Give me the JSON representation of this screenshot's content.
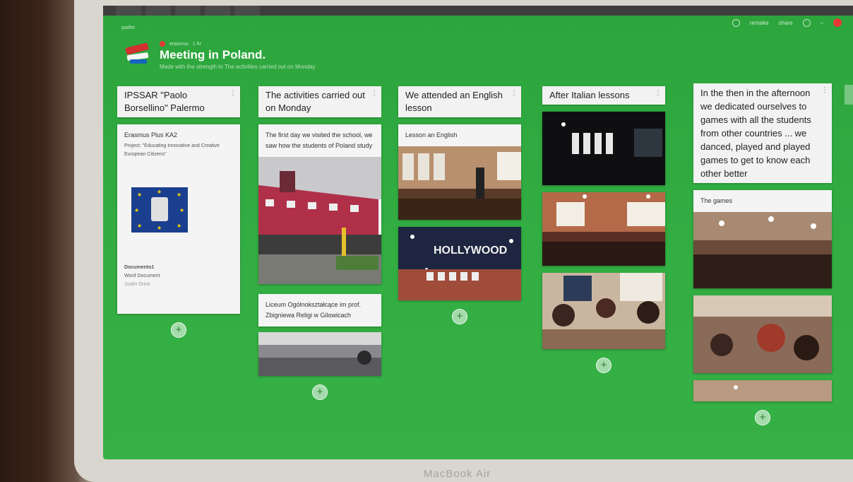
{
  "board": {
    "title": "Meeting in Poland.",
    "subtitle": "Made with the strength to The activities carried out on Monday",
    "author_name": "erasmus",
    "author_time": "1 hr"
  },
  "browser_tabs": [
    "",
    "",
    "",
    "",
    ""
  ],
  "topbar": {
    "item1": "remake",
    "item2": "share"
  },
  "columns": [
    {
      "header": "IPSSAR \"Paolo Borsellino\" Palermo",
      "card1_title": "Erasmus Plus KA2",
      "card1_body": "Project: \"Educating Innovative and Creative European Citizens\"",
      "attachment_name": "Documento1",
      "attachment_type": "Word Document",
      "attachment_src": "Justin Drive"
    },
    {
      "header": "The activities carried out on Monday",
      "card1_text": "The first day we visited the school, we saw how the students of Poland study",
      "card2_text": "Liceum Ogólnokształcące im prof. Zbigniewa Religi w Gilowicach"
    },
    {
      "header": "We attended an English lesson",
      "card1_title": "Lesson an English",
      "sign_text": "HOLLYWOOD"
    },
    {
      "header": "After Italian lessons"
    },
    {
      "header": "In the  then in the afternoon we dedicated ourselves to games with all the students from other countries ... we danced, played and played games to get to know each other better",
      "card1_title": "The games"
    }
  ],
  "add_label": "+",
  "kebab": "⋮"
}
